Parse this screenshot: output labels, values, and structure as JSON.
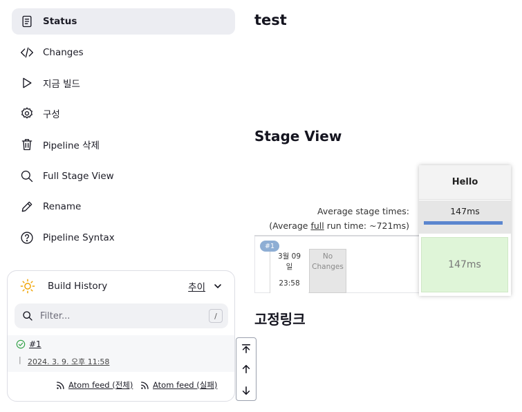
{
  "sidebar": {
    "items": [
      {
        "label": "Status",
        "icon": "status-icon",
        "active": true
      },
      {
        "label": "Changes",
        "icon": "code-icon"
      },
      {
        "label": "지금 빌드",
        "icon": "play-icon"
      },
      {
        "label": "구성",
        "icon": "gear-icon"
      },
      {
        "label": "Pipeline 삭제",
        "icon": "trash-icon"
      },
      {
        "label": "Full Stage View",
        "icon": "search-icon"
      },
      {
        "label": "Rename",
        "icon": "pencil-icon"
      },
      {
        "label": "Pipeline Syntax",
        "icon": "help-circle-icon"
      }
    ]
  },
  "build_history": {
    "title": "Build History",
    "trend_label": "추이",
    "filter_placeholder": "Filter...",
    "filter_shortcut": "/",
    "builds": [
      {
        "number": "#1",
        "date": "2024. 3. 9. 오후 11:58",
        "status": "success"
      }
    ],
    "feed_all": "Atom feed (전체)",
    "feed_failed": "Atom feed (실패)"
  },
  "main": {
    "title": "test",
    "stage_view_title": "Stage View",
    "permalinks_title": "고정링크"
  },
  "stage_view": {
    "average_stage_times_label": "Average stage times:",
    "average_full_prefix": "(Average ",
    "average_full_link": "full",
    "average_full_suffix": " run time: ~721ms)",
    "stages": [
      {
        "name": "Hello",
        "average": "147ms",
        "average_fraction": 1.0
      }
    ],
    "runs": [
      {
        "badge": "#1",
        "date_line1": "3월 09",
        "date_line2": "일",
        "time": "23:58",
        "changes_line1": "No",
        "changes_line2": "Changes",
        "stage_times": [
          "147ms"
        ]
      }
    ]
  },
  "colors": {
    "success_cell": "#dff5d8",
    "progress_fill": "#5b86cf",
    "badge": "#8eaed4",
    "active_item_bg": "#ecedf2"
  }
}
